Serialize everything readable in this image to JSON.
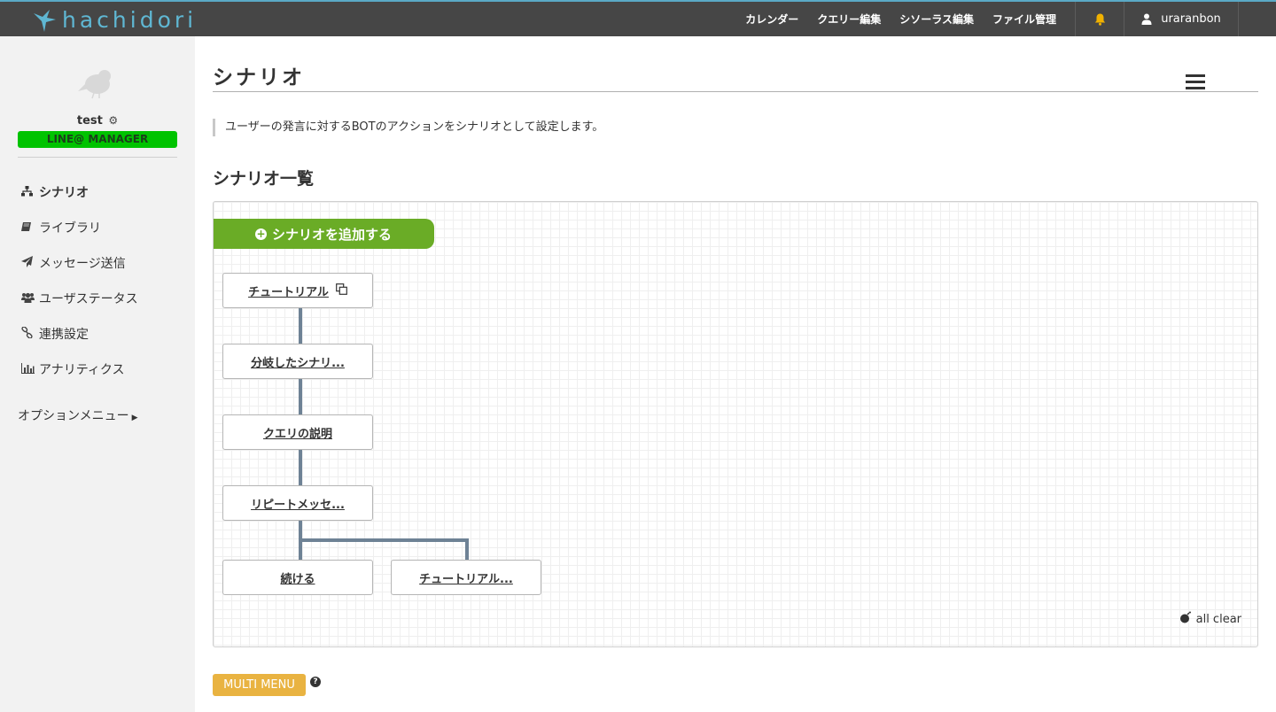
{
  "brand": {
    "name": "hachidori"
  },
  "topnav": {
    "links": [
      "カレンダー",
      "クエリー編集",
      "シソーラス編集",
      "ファイル管理"
    ],
    "bell_icon": "bell-icon",
    "username": "uraranbon"
  },
  "sidebar": {
    "account_name": "test",
    "badge": "LINE@ MANAGER",
    "items": [
      {
        "label": "シナリオ",
        "icon": "sitemap-icon",
        "active": true
      },
      {
        "label": "ライブラリ",
        "icon": "book-icon",
        "active": false
      },
      {
        "label": "メッセージ送信",
        "icon": "paper-plane-icon",
        "active": false
      },
      {
        "label": "ユーザステータス",
        "icon": "users-icon",
        "active": false
      },
      {
        "label": "連携設定",
        "icon": "link-icon",
        "active": false
      },
      {
        "label": "アナリティクス",
        "icon": "bar-chart-icon",
        "active": false
      }
    ],
    "option_menu": "オプションメニュー"
  },
  "main": {
    "title": "シナリオ",
    "description": "ユーザーの発言に対するBOTのアクションをシナリオとして設定します。",
    "section_title": "シナリオ一覧",
    "add_button": "シナリオを追加する",
    "nodes": [
      {
        "label": "チュートリアル"
      },
      {
        "label": "分岐したシナリ..."
      },
      {
        "label": "クエリの説明"
      },
      {
        "label": "リピートメッセ..."
      },
      {
        "label": "続ける"
      },
      {
        "label": "チュートリアル..."
      }
    ],
    "all_clear": "all clear",
    "multi_menu": "MULTI MENU"
  },
  "colors": {
    "topbar": "#464646",
    "brand": "#5fb7d3",
    "line_green": "#00c300",
    "add_green": "#6aac26",
    "connector": "#6e8295",
    "multi_menu": "#e9b341"
  }
}
